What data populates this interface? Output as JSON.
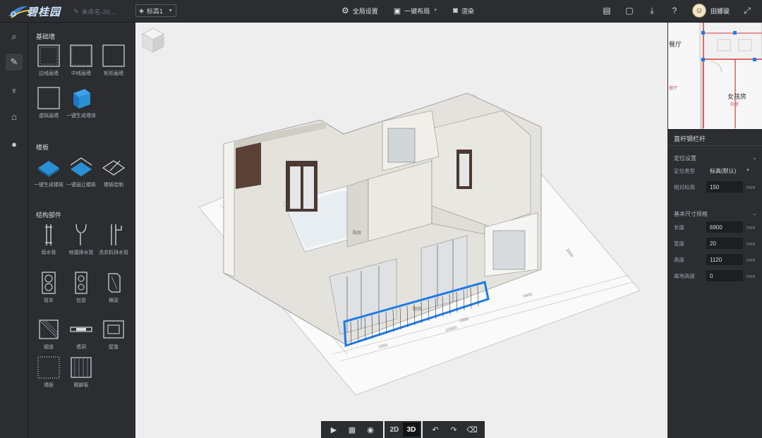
{
  "app": {
    "brand": "碧桂园",
    "file_name": "未命名-20...",
    "layer": "标高1"
  },
  "toolbar": {
    "global_settings": "全局设置",
    "one_click_layout": "一键布局",
    "render": "渲染",
    "user_name": "田娜骏"
  },
  "library": {
    "sections": [
      {
        "title": "基础墙",
        "items": [
          "边线画墙",
          "中线画墙",
          "矩形画墙",
          "虚拟画墙",
          "一键生成墙体"
        ]
      },
      {
        "title": "楼板",
        "items": [
          "一键生成楼板",
          "一键画让楼板",
          "楼板绘制"
        ]
      },
      {
        "title": "结构部件",
        "items": [
          "雨水管",
          "地漏排水管",
          "洗衣机排水管",
          "管井",
          "包管",
          "横梁",
          "烟道",
          "墙洞",
          "壁龛",
          "墙板",
          "踢脚板"
        ]
      }
    ]
  },
  "viewer": {
    "mode_2d": "2D",
    "mode_3d": "3D",
    "active_mode": "3D",
    "plan_labels": [
      "阳台",
      "阳台"
    ],
    "dimensions": [
      "3900",
      "10400",
      "3900",
      "5400",
      "3900",
      "1800"
    ]
  },
  "minimap": {
    "labels": [
      "餐厅",
      "女孩房",
      "卧室",
      "餐厅"
    ]
  },
  "properties": {
    "title": "直杆钢栏杆",
    "position_group": "定位设置",
    "position_type_label": "定位类型",
    "position_type_value": "标高(默认)",
    "relative_height_label": "相对标高",
    "relative_height_value": "150",
    "size_group": "基本尺寸规格",
    "length_label": "长度",
    "length_value": "6900",
    "width_label": "宽度",
    "width_value": "20",
    "height_label": "高度",
    "height_value": "1120",
    "offset_label": "离地高度",
    "offset_value": "0",
    "unit": "mm"
  },
  "colors": {
    "selection": "#1e7be6",
    "panel_bg": "#2b2d30",
    "canvas_bg": "#eeeeee"
  }
}
